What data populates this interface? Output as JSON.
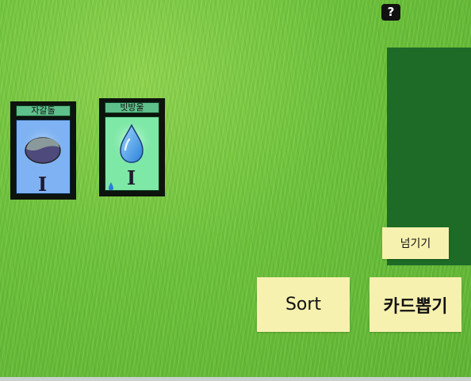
{
  "help_button": {
    "label": "?"
  },
  "cards": [
    {
      "name": "자갈돌",
      "level": "I"
    },
    {
      "name": "빗방울",
      "level": "I"
    }
  ],
  "buttons": {
    "pass": "넘기기",
    "sort": "Sort",
    "draw_card": "카드뽑기"
  },
  "colors": {
    "card_gravel_bg": "#7fb2f2",
    "card_rain_bg": "#7ee8a7",
    "panel": "#1e6b28",
    "button": "#f7f1b0"
  }
}
